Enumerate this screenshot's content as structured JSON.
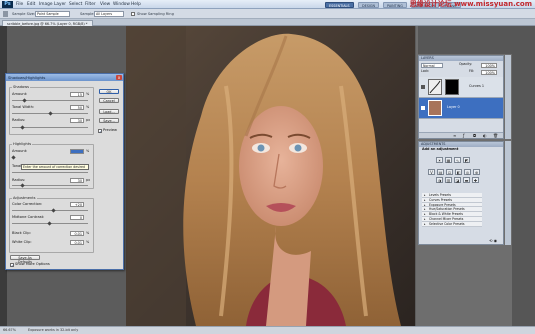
{
  "app": {
    "logo": "Ps",
    "menu": [
      "File",
      "Edit",
      "Image",
      "Layer",
      "Select",
      "Filter",
      "View",
      "Window",
      "Help"
    ],
    "workspaces": [
      "ESSENTIALS",
      "DESIGN",
      "PAINTING",
      "NEW IN CS5"
    ],
    "search_placeholder": "CS Live",
    "watermark": "思缘设计论坛 www.missyuan.com"
  },
  "options_bar": {
    "sample_size_label": "Sample Size:",
    "sample_size_value": "Point Sample",
    "sample_label": "Sample:",
    "sample_value": "All Layers",
    "show_ring_label": "Show Sampling Ring"
  },
  "document": {
    "tab_label": "scribble_before.jpg @ 66.7% (Layer 0, RGB/8) *"
  },
  "status": {
    "zoom": "66.67%",
    "info": "Exposure works in 32-bit only"
  },
  "dialog": {
    "title": "Shadows/Highlights",
    "close": "x",
    "shadows": {
      "title": "Shadows",
      "amount_label": "Amount:",
      "amount": "15",
      "tonal_label": "Tonal Width:",
      "tonal": "50",
      "radius_label": "Radius:",
      "radius": "30",
      "unit_pct": "%",
      "unit_px": "px",
      "amount_frac": 0.15,
      "tonal_frac": 0.5,
      "radius_frac": 0.12
    },
    "highlights": {
      "title": "Highlights",
      "amount_label": "Amount:",
      "amount": "",
      "tonal_label": "Tonal",
      "tonal": "",
      "radius_label": "Radius:",
      "radius": "30",
      "amount_frac": 0.0,
      "radius_frac": 0.12
    },
    "tooltip": "Enter the amount of correction desired",
    "adjustments": {
      "title": "Adjustments",
      "color_label": "Color Correction:",
      "color": "+20",
      "midtone_label": "Midtone Contrast:",
      "midtone": "0",
      "black_label": "Black Clip:",
      "black": "0.01",
      "white_label": "White Clip:",
      "white": "0.01"
    },
    "buttons": [
      "OK",
      "Cancel",
      "Load...",
      "Save..."
    ],
    "preview_label": "Preview",
    "save_defaults": "Save As Defaults",
    "show_more": "Show More Options"
  },
  "layers_panel": {
    "tab": "LAYERS",
    "blend": "Normal",
    "opacity_label": "Opacity:",
    "opacity": "100%",
    "lock_label": "Lock:",
    "fill_label": "Fill:",
    "fill": "100%",
    "layers": [
      {
        "name": "Curves 1"
      },
      {
        "name": "Layer 0"
      }
    ]
  },
  "adjustments_panel": {
    "tab": "ADJUSTMENTS",
    "header": "Add an adjustment",
    "presets": [
      "Levels Presets",
      "Curves Presets",
      "Exposure Presets",
      "Hue/Saturation Presets",
      "Black & White Presets",
      "Channel Mixer Presets",
      "Selective Color Presets"
    ]
  },
  "colors": {
    "accent": "#3d6fc0",
    "dialog_bg": "#dcdcdc",
    "watermark": "#c1272d"
  }
}
